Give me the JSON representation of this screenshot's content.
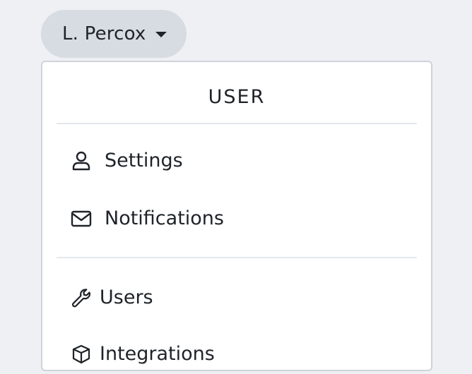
{
  "user_menu": {
    "toggle_label": "L. Percox",
    "caret_icon": "caret-down-icon",
    "header": "USER",
    "items": [
      {
        "label": "Settings",
        "icon": "user-icon"
      },
      {
        "label": "Notifications",
        "icon": "envelope-icon"
      },
      {
        "label": "Users",
        "icon": "wrench-icon"
      },
      {
        "label": "Integrations",
        "icon": "box-icon"
      }
    ]
  }
}
